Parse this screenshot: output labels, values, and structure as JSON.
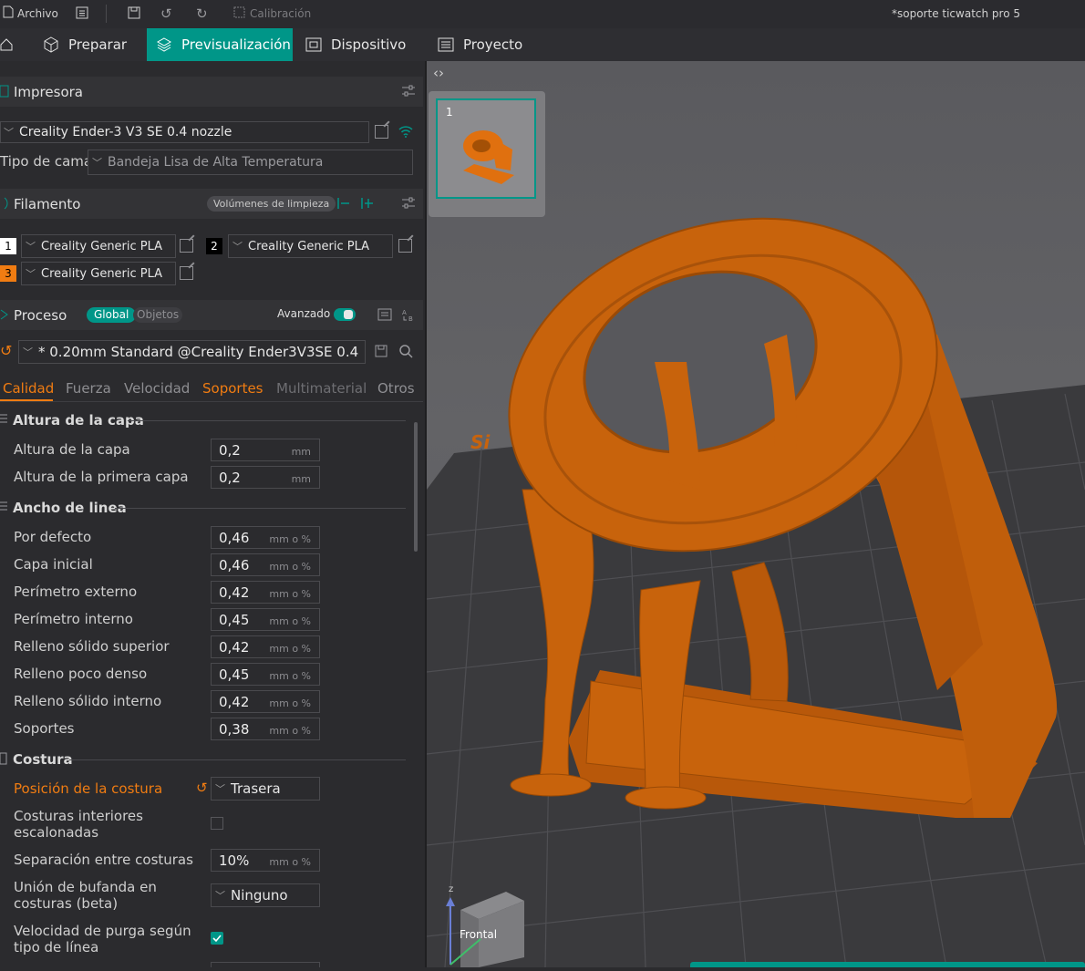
{
  "titlebar": {
    "file_label": "Archivo",
    "calibration_label": "Calibración",
    "window_title": "*soporte ticwatch pro 5"
  },
  "nav": {
    "prepare": "Preparar",
    "preview": "Previsualización",
    "device": "Dispositivo",
    "project": "Proyecto"
  },
  "printer": {
    "section_title": "Impresora",
    "selected": "Creality Ender-3 V3 SE 0.4 nozzle",
    "bed_label": "Tipo de cama",
    "bed_value": "Bandeja Lisa de Alta Temperatura"
  },
  "filament": {
    "section_title": "Filamento",
    "flush_button": "Volúmenes de limpieza",
    "slots": [
      {
        "num": "1",
        "name": "Creality Generic PLA",
        "color": "#ffffff"
      },
      {
        "num": "2",
        "name": "Creality Generic PLA",
        "color": "#000000"
      },
      {
        "num": "3",
        "name": "Creality Generic PLA",
        "color": "#f07c12"
      }
    ]
  },
  "process": {
    "section_title": "Proceso",
    "global": "Global",
    "objects": "Objetos",
    "advanced": "Avanzado",
    "advanced_on": true,
    "preset": "* 0.20mm Standard @Creality Ender3V3SE 0.4",
    "tabs": [
      "Calidad",
      "Fuerza",
      "Velocidad",
      "Soportes",
      "Multimaterial",
      "Otros"
    ],
    "active_tab": "Calidad"
  },
  "quality": {
    "layer_group": "Altura de la capa",
    "layer_height_label": "Altura de la capa",
    "layer_height": "0,2",
    "first_layer_label": "Altura de la primera capa",
    "first_layer": "0,2",
    "unit_mm": "mm",
    "line_group": "Ancho de linea",
    "unit_mmpct": "mm o %",
    "line_rows": [
      {
        "label": "Por defecto",
        "value": "0,46"
      },
      {
        "label": "Capa inicial",
        "value": "0,46"
      },
      {
        "label": "Perímetro externo",
        "value": "0,42"
      },
      {
        "label": "Perímetro interno",
        "value": "0,45"
      },
      {
        "label": "Relleno sólido superior",
        "value": "0,42"
      },
      {
        "label": "Relleno poco denso",
        "value": "0,45"
      },
      {
        "label": "Relleno sólido interno",
        "value": "0,42"
      },
      {
        "label": "Soportes",
        "value": "0,38"
      }
    ],
    "seam_group": "Costura",
    "seam_position_label": "Posición de la costura",
    "seam_position_value": "Trasera",
    "inner_seams_label_1": "Costuras interiores",
    "inner_seams_label_2": "escalonadas",
    "inner_seams_checked": false,
    "seam_gap_label": "Separación entre costuras",
    "seam_gap_value": "10%",
    "scarf_label_1": "Unión de bufanda en",
    "scarf_label_2": "costuras (beta)",
    "scarf_value": "Ninguno",
    "wipe_label_1": "Velocidad de purga según",
    "wipe_label_2": "tipo de línea",
    "wipe_checked": true
  },
  "viewport": {
    "plate_number": "1",
    "view_cube_front": "Frontal",
    "axis_z": "z",
    "model_color": "#c8630c",
    "bed_text": "Si"
  }
}
